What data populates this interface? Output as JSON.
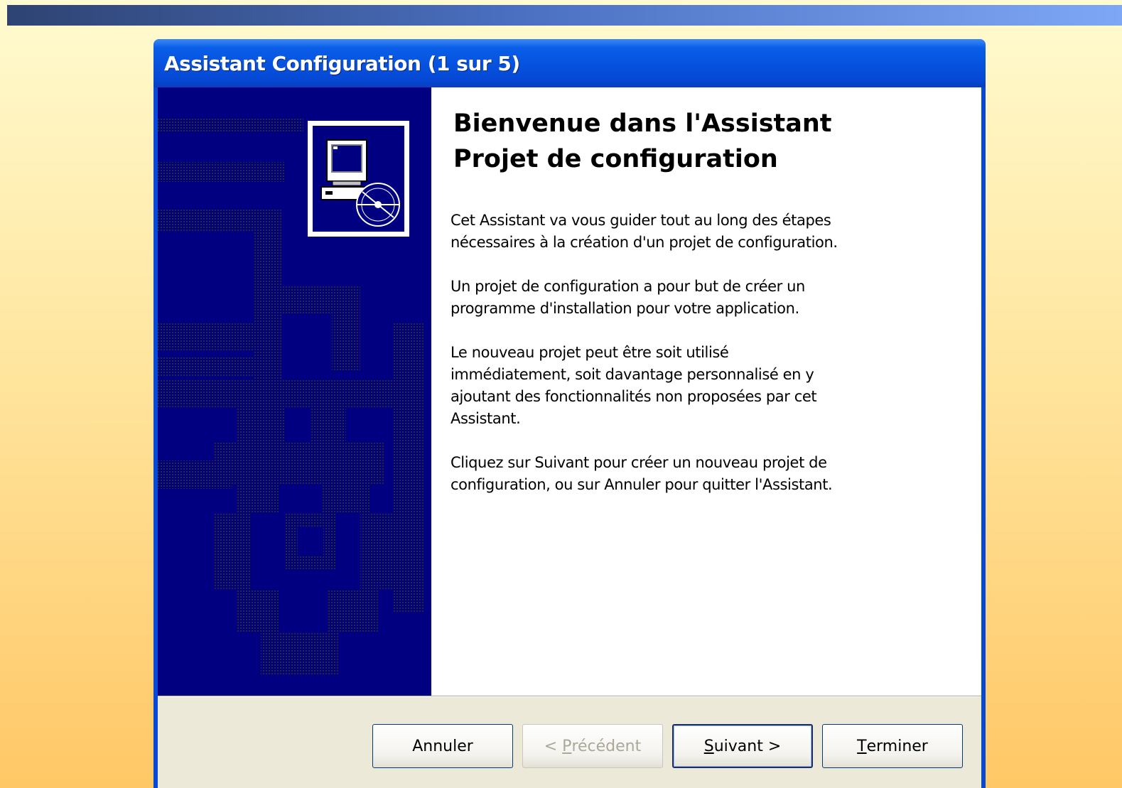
{
  "window": {
    "title": "Assistant Configuration (1 sur 5)"
  },
  "content": {
    "heading_lines": [
      "Bienvenue dans l'Assistant",
      "Projet de configuration"
    ],
    "paragraphs": [
      [
        "Cet Assistant va vous guider tout au long des étapes",
        "nécessaires à la création d'un projet de configuration."
      ],
      [
        "Un projet de configuration a pour but de créer un",
        "programme d'installation pour  votre application."
      ],
      [
        "Le nouveau projet peut être soit utilisé",
        "immédiatement, soit davantage personnalisé en y",
        "ajoutant des fonctionnalités non proposées par cet",
        "Assistant."
      ],
      [
        "Cliquez sur Suivant pour créer un nouveau projet de",
        "configuration, ou sur Annuler pour quitter l'Assistant."
      ]
    ]
  },
  "buttons": {
    "cancel": {
      "label": "Annuler"
    },
    "back": {
      "prefix": "< ",
      "mnemonic": "P",
      "rest": "récédent",
      "enabled": false
    },
    "next": {
      "mnemonic": "S",
      "rest": "uivant >"
    },
    "finish": {
      "mnemonic": "T",
      "rest": "erminer"
    }
  },
  "icons": {
    "side_panel": "setup-computer-cd-icon",
    "background_art": "gear-pattern-icon"
  },
  "colors": {
    "title_bar": "#0653e0",
    "side_panel": "#000080",
    "dialog_face": "#ece9d8",
    "banner_start": "#2e4372",
    "banner_end": "#7ea7f5"
  }
}
